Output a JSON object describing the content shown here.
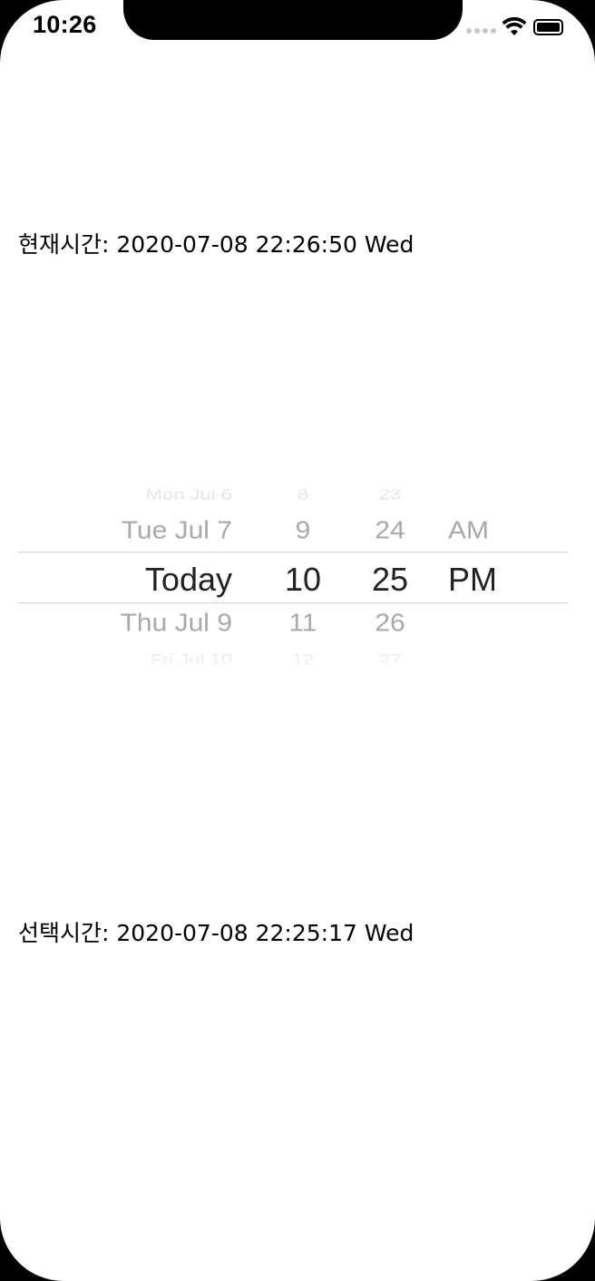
{
  "status_bar": {
    "time": "10:26",
    "icons": [
      "cellular-signal-icon",
      "wifi-icon",
      "battery-icon"
    ]
  },
  "current_time": {
    "label": "현재시간: 2020-07-08 22:26:50 Wed"
  },
  "date_picker": {
    "date_column": [
      "Mon Jul 6",
      "Tue Jul 7",
      "Today",
      "Thu Jul 9",
      "Fri Jul 10"
    ],
    "hour_column": [
      "8",
      "9",
      "10",
      "11",
      "12"
    ],
    "minute_column": [
      "23",
      "24",
      "25",
      "26",
      "27"
    ],
    "ampm_column": [
      "AM",
      "PM"
    ],
    "selected": {
      "date": "Today",
      "hour": "10",
      "minute": "25",
      "ampm": "PM"
    }
  },
  "selected_time": {
    "label": "선택시간: 2020-07-08 22:25:17 Wed"
  },
  "colors": {
    "background": "#ffffff",
    "selected_text": "#222222",
    "faded_text": "#a9a9a9",
    "separator": "#d4d4d6"
  }
}
